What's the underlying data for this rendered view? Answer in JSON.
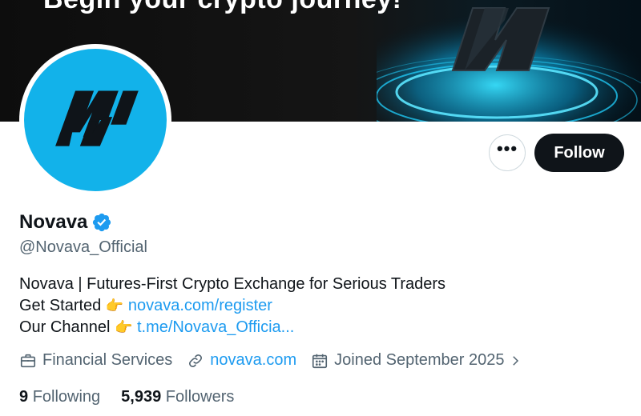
{
  "banner": {
    "tagline": "Begin your crypto journey!"
  },
  "profile": {
    "display_name": "Novava",
    "handle": "@Novava_Official",
    "bio": {
      "line1": "Novava | Futures-First Crypto Exchange for Serious Traders",
      "line2_prefix": "Get Started",
      "line2_link": "novava.com/register",
      "line3_prefix": "Our Channel",
      "line3_link": "t.me/Novava_Officia..."
    },
    "meta": {
      "category": "Financial Services",
      "website": "novava.com",
      "joined": "Joined September 2025"
    },
    "stats": {
      "following_count": "9",
      "following_label": "Following",
      "followers_count": "5,939",
      "followers_label": "Followers"
    }
  },
  "actions": {
    "more_label": "•••",
    "follow_label": "Follow"
  },
  "colors": {
    "brand_blue": "#12b2ea",
    "link_blue": "#1d9bf0",
    "text_primary": "#0f1419",
    "text_secondary": "#536471",
    "follow_button_bg": "#0f1419"
  },
  "icons": {
    "verified": "verified-badge-icon",
    "pointer": "pointing-hand-emoji",
    "category": "briefcase-icon",
    "website": "link-icon",
    "joined": "calendar-icon",
    "chevron": "chevron-right-icon"
  }
}
